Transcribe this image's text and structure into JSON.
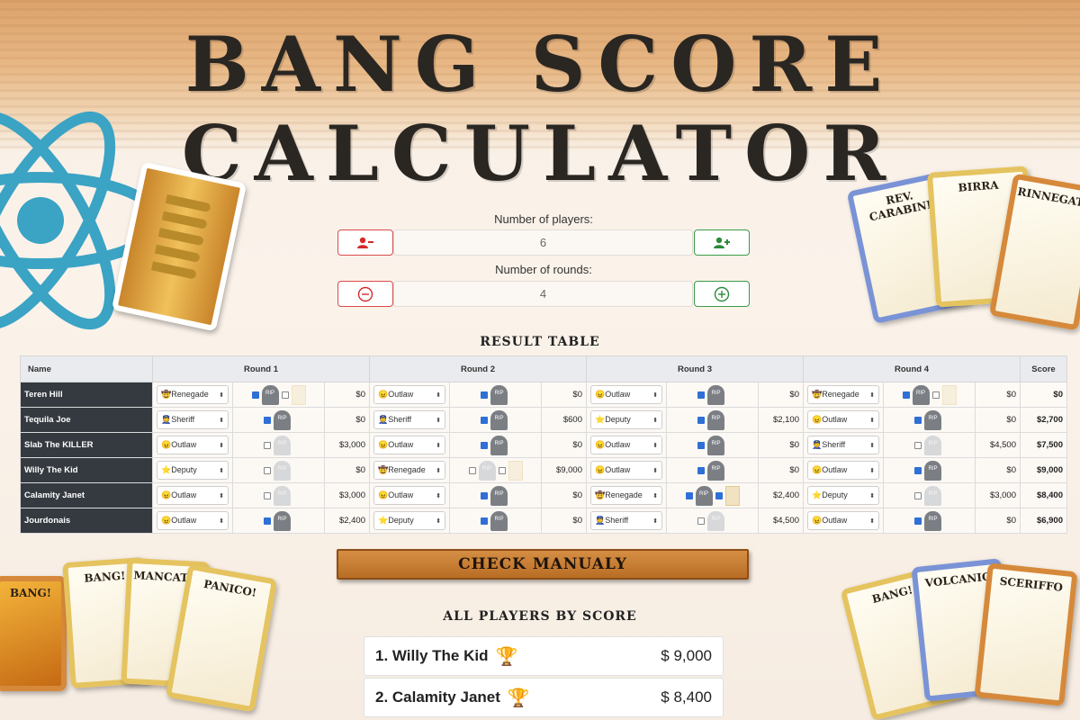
{
  "header": {
    "title": "BANG SCORE CALCULATOR"
  },
  "decor_cards": {
    "top_right": [
      "REV. CARABINE",
      "BIRRA",
      "RINNEGATO"
    ],
    "bottom_left": [
      "BANG!",
      "BANG!",
      "MANCATO!",
      "PANICO!"
    ],
    "bottom_right": [
      "BANG!",
      "VOLCANIC",
      "SCERIFFO"
    ]
  },
  "controls": {
    "players_label": "Number of players:",
    "players_value": "6",
    "rounds_label": "Number of rounds:",
    "rounds_value": "4"
  },
  "result_table": {
    "title": "RESULT TABLE",
    "headers": [
      "Name",
      "Round 1",
      "Round 2",
      "Round 3",
      "Round 4",
      "Score"
    ],
    "rows": [
      {
        "name": "Teren Hill",
        "score": "$0",
        "rounds": [
          {
            "role": "Renegade",
            "role_icon": "🤠",
            "checks": [
              true,
              false
            ],
            "tomb_alive": true,
            "extra_card": true,
            "money": "$0"
          },
          {
            "role": "Outlaw",
            "role_icon": "😠",
            "checks": [
              true
            ],
            "tomb_alive": true,
            "extra_card": false,
            "money": "$0"
          },
          {
            "role": "Outlaw",
            "role_icon": "😠",
            "checks": [
              true
            ],
            "tomb_alive": true,
            "extra_card": false,
            "money": "$0"
          },
          {
            "role": "Renegade",
            "role_icon": "🤠",
            "checks": [
              true,
              false
            ],
            "tomb_alive": true,
            "extra_card": true,
            "money": "$0"
          }
        ]
      },
      {
        "name": "Tequila Joe",
        "score": "$2,700",
        "rounds": [
          {
            "role": "Sheriff",
            "role_icon": "👮",
            "checks": [
              true
            ],
            "tomb_alive": true,
            "extra_card": false,
            "money": "$0"
          },
          {
            "role": "Sheriff",
            "role_icon": "👮",
            "checks": [
              true
            ],
            "tomb_alive": true,
            "extra_card": false,
            "money": "$600"
          },
          {
            "role": "Deputy",
            "role_icon": "⭐",
            "checks": [
              true
            ],
            "tomb_alive": true,
            "extra_card": false,
            "money": "$2,100"
          },
          {
            "role": "Outlaw",
            "role_icon": "😠",
            "checks": [
              true
            ],
            "tomb_alive": true,
            "extra_card": false,
            "money": "$0"
          }
        ]
      },
      {
        "name": "Slab The KILLER",
        "score": "$7,500",
        "rounds": [
          {
            "role": "Outlaw",
            "role_icon": "😠",
            "checks": [
              false
            ],
            "tomb_alive": false,
            "extra_card": false,
            "money": "$3,000"
          },
          {
            "role": "Outlaw",
            "role_icon": "😠",
            "checks": [
              true
            ],
            "tomb_alive": true,
            "extra_card": false,
            "money": "$0"
          },
          {
            "role": "Outlaw",
            "role_icon": "😠",
            "checks": [
              true
            ],
            "tomb_alive": true,
            "extra_card": false,
            "money": "$0"
          },
          {
            "role": "Sheriff",
            "role_icon": "👮",
            "checks": [
              false
            ],
            "tomb_alive": false,
            "extra_card": false,
            "money": "$4,500"
          }
        ]
      },
      {
        "name": "Willy The Kid",
        "score": "$9,000",
        "rounds": [
          {
            "role": "Deputy",
            "role_icon": "⭐",
            "checks": [
              false
            ],
            "tomb_alive": false,
            "extra_card": false,
            "money": "$0"
          },
          {
            "role": "Renegade",
            "role_icon": "🤠",
            "checks": [
              false,
              false
            ],
            "tomb_alive": false,
            "extra_card": true,
            "money": "$9,000"
          },
          {
            "role": "Outlaw",
            "role_icon": "😠",
            "checks": [
              true
            ],
            "tomb_alive": true,
            "extra_card": false,
            "money": "$0"
          },
          {
            "role": "Outlaw",
            "role_icon": "😠",
            "checks": [
              true
            ],
            "tomb_alive": true,
            "extra_card": false,
            "money": "$0"
          }
        ]
      },
      {
        "name": "Calamity Janet",
        "score": "$8,400",
        "rounds": [
          {
            "role": "Outlaw",
            "role_icon": "😠",
            "checks": [
              false
            ],
            "tomb_alive": false,
            "extra_card": false,
            "money": "$3,000"
          },
          {
            "role": "Outlaw",
            "role_icon": "😠",
            "checks": [
              true
            ],
            "tomb_alive": true,
            "extra_card": false,
            "money": "$0"
          },
          {
            "role": "Renegade",
            "role_icon": "🤠",
            "checks": [
              true,
              true
            ],
            "tomb_alive": true,
            "extra_card": true,
            "money": "$2,400"
          },
          {
            "role": "Deputy",
            "role_icon": "⭐",
            "checks": [
              false
            ],
            "tomb_alive": false,
            "extra_card": false,
            "money": "$3,000"
          }
        ]
      },
      {
        "name": "Jourdonais",
        "score": "$6,900",
        "rounds": [
          {
            "role": "Outlaw",
            "role_icon": "😠",
            "checks": [
              true
            ],
            "tomb_alive": true,
            "extra_card": false,
            "money": "$2,400"
          },
          {
            "role": "Deputy",
            "role_icon": "⭐",
            "checks": [
              true
            ],
            "tomb_alive": true,
            "extra_card": false,
            "money": "$0"
          },
          {
            "role": "Sheriff",
            "role_icon": "👮",
            "checks": [
              false
            ],
            "tomb_alive": false,
            "extra_card": false,
            "money": "$4,500"
          },
          {
            "role": "Outlaw",
            "role_icon": "😠",
            "checks": [
              true
            ],
            "tomb_alive": true,
            "extra_card": false,
            "money": "$0"
          }
        ]
      }
    ]
  },
  "tomb_label": "RIP",
  "check_button_label": "CHECK MANUALY",
  "ranking": {
    "title": "ALL PLAYERS BY SCORE",
    "items": [
      {
        "label": "1. Willy The Kid",
        "score": "$ 9,000",
        "trophy": "gold"
      },
      {
        "label": "2. Calamity Janet",
        "score": "$ 8,400",
        "trophy": "silver"
      }
    ]
  },
  "colors": {
    "accent_red": "#d42a2a",
    "accent_green": "#2a8b3a",
    "wood": "#c47a34",
    "dark_cell": "#343a40"
  }
}
